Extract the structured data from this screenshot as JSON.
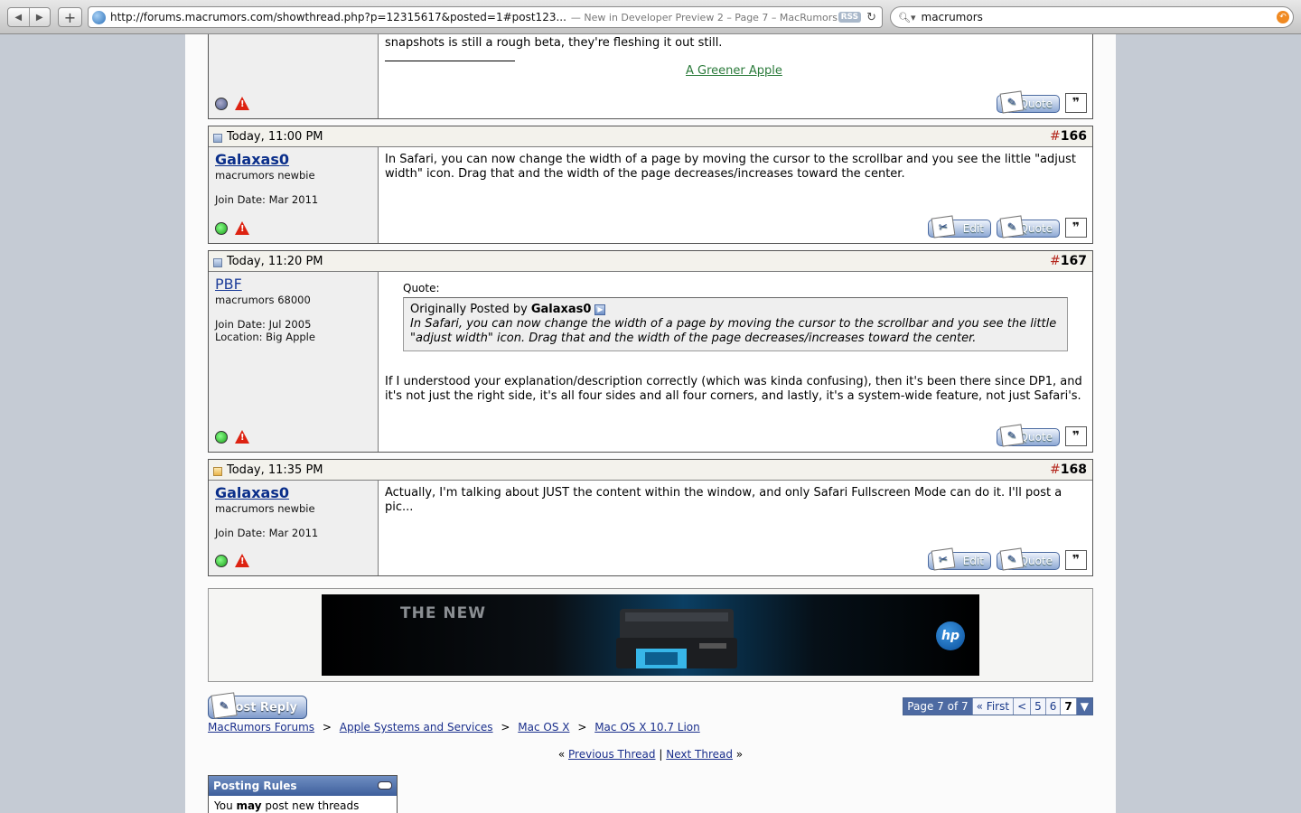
{
  "browser": {
    "back_icon": "back-arrow-icon",
    "forward_icon": "forward-arrow-icon",
    "add_label": "+",
    "url": "http://forums.macrumors.com/showthread.php?p=12315617&posted=1#post123...",
    "page_title": "— New in Developer Preview 2 – Page 7 – MacRumors ...",
    "rss_label": "RSS",
    "search_value": "macrumors"
  },
  "prev_post": {
    "text_tail": "snapshots is still a rough beta, they're fleshing it out still.",
    "signature": "A Greener Apple",
    "quote_label": "Quote"
  },
  "posts": [
    {
      "time": "Today, 11:00 PM",
      "hash": "#",
      "number": "166",
      "user": "Galaxas0",
      "title": "macrumors newbie",
      "join": "Join Date: Mar 2011",
      "body": "In Safari, you can now change the width of a page by moving the cursor to the scrollbar and you see the little \"adjust width\" icon. Drag that and the width of the page decreases/increases toward the center.",
      "edit_label": "Edit",
      "quote_label": "Quote"
    },
    {
      "time": "Today, 11:20 PM",
      "hash": "#",
      "number": "167",
      "user": "PBF",
      "title": "macrumors 68000",
      "join": "Join Date: Jul 2005",
      "location": "Location: Big Apple",
      "quote_header": "Quote:",
      "quote_by_prefix": "Originally Posted by",
      "quote_author": "Galaxas0",
      "quote_text": "In Safari, you can now change the width of a page by moving the cursor to the scrollbar and you see the little \"adjust width\" icon. Drag that and the width of the page decreases/increases toward the center.",
      "body": "If I understood your explanation/description correctly (which was kinda confusing), then it's been there since DP1, and it's not just the right side, it's all four sides and all four corners, and lastly, it's a system-wide feature, not just Safari's.",
      "quote_label": "Quote"
    },
    {
      "time": "Today, 11:35 PM",
      "hash": "#",
      "number": "168",
      "user": "Galaxas0",
      "title": "macrumors newbie",
      "join": "Join Date: Mar 2011",
      "body": "Actually, I'm talking about JUST the content within the window, and only Safari Fullscreen Mode can do it. I'll post a pic...",
      "edit_label": "Edit",
      "quote_label": "Quote"
    }
  ],
  "ad": {
    "headline": "THE NEW",
    "brand": "hp"
  },
  "footer": {
    "post_reply": "Post Reply",
    "pager": {
      "label": "Page 7 of 7",
      "first": "« First",
      "prev": "<",
      "pages": [
        "5",
        "6",
        "7"
      ]
    },
    "breadcrumbs": [
      "MacRumors Forums",
      "Apple Systems and Services",
      "Mac OS X",
      "Mac OS X 10.7 Lion"
    ],
    "breadcrumb_sep": ">",
    "prev_thread": "Previous Thread",
    "next_thread": "Next Thread",
    "nav_divider": "|",
    "nav_left": "«",
    "nav_right": "»",
    "rules_title": "Posting Rules",
    "rules_you": "You",
    "rules_may": "may",
    "rules_rest": "post new threads"
  },
  "colors": {
    "link": "#1a2f8c",
    "post_number": "#b4261c",
    "header_bg": "#f3f2ec"
  }
}
